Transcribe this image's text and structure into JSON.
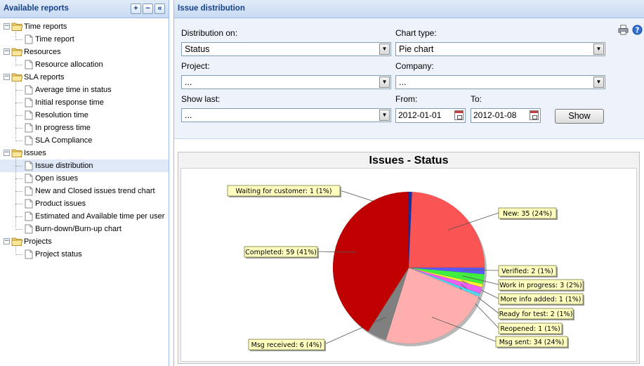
{
  "left_panel": {
    "title": "Available reports",
    "tools": [
      "+",
      "−",
      "«"
    ],
    "tree": [
      {
        "type": "folder",
        "label": "Time reports",
        "children": [
          "Time report"
        ]
      },
      {
        "type": "folder",
        "label": "Resources",
        "children": [
          "Resource allocation"
        ]
      },
      {
        "type": "folder",
        "label": "SLA reports",
        "children": [
          "Average time in status",
          "Initial response time",
          "Resolution time",
          "In progress time",
          "SLA Compliance"
        ]
      },
      {
        "type": "folder",
        "label": "Issues",
        "children": [
          "Issue distribution",
          "Open issues",
          "New and Closed issues trend chart",
          "Product issues",
          "Estimated and Available time per user",
          "Burn-down/Burn-up chart"
        ]
      },
      {
        "type": "folder",
        "label": "Projects",
        "children": [
          "Project status"
        ]
      }
    ],
    "selected": "Issue distribution"
  },
  "right_panel": {
    "title": "Issue distribution",
    "form": {
      "distribution_label": "Distribution on:",
      "distribution_value": "Status",
      "chart_type_label": "Chart type:",
      "chart_type_value": "Pie chart",
      "project_label": "Project:",
      "project_value": "...",
      "company_label": "Company:",
      "company_value": "...",
      "show_last_label": "Show last:",
      "show_last_value": "...",
      "from_label": "From:",
      "from_value": "2012-01-01",
      "to_label": "To:",
      "to_value": "2012-01-08",
      "show_button": "Show"
    },
    "icons": [
      "printer-icon",
      "help-icon"
    ]
  },
  "chart_data": {
    "type": "pie",
    "title": "Issues - Status",
    "slices": [
      {
        "label": "Waiting for customer",
        "value": 1,
        "percent": 1,
        "color": "#1a2fa0",
        "text": "Waiting for customer: 1 (1%)"
      },
      {
        "label": "New",
        "value": 35,
        "percent": 24,
        "color": "#fa5454",
        "text": "New: 35 (24%)"
      },
      {
        "label": "Verified",
        "value": 2,
        "percent": 1,
        "color": "#5a5aff",
        "text": "Verified: 2 (1%)"
      },
      {
        "label": "Work in progress",
        "value": 3,
        "percent": 2,
        "color": "#40ee40",
        "text": "Work in progress: 3 (2%)"
      },
      {
        "label": "More info added",
        "value": 1,
        "percent": 1,
        "color": "#f2f230",
        "text": "More info added: 1 (1%)"
      },
      {
        "label": "Ready for test",
        "value": 2,
        "percent": 1,
        "color": "#f060f0",
        "text": "Ready for test: 2 (1%)"
      },
      {
        "label": "Reopened",
        "value": 1,
        "percent": 1,
        "color": "#50d8ee",
        "text": "Reopened: 1 (1%)"
      },
      {
        "label": "Msg sent",
        "value": 34,
        "percent": 24,
        "color": "#ffaeae",
        "text": "Msg sent: 34 (24%)"
      },
      {
        "label": "Msg received",
        "value": 6,
        "percent": 4,
        "color": "#808080",
        "text": "Msg received: 6 (4%)"
      },
      {
        "label": "Completed",
        "value": 59,
        "percent": 41,
        "color": "#c00000",
        "text": "Completed: 59 (41%)"
      }
    ]
  }
}
